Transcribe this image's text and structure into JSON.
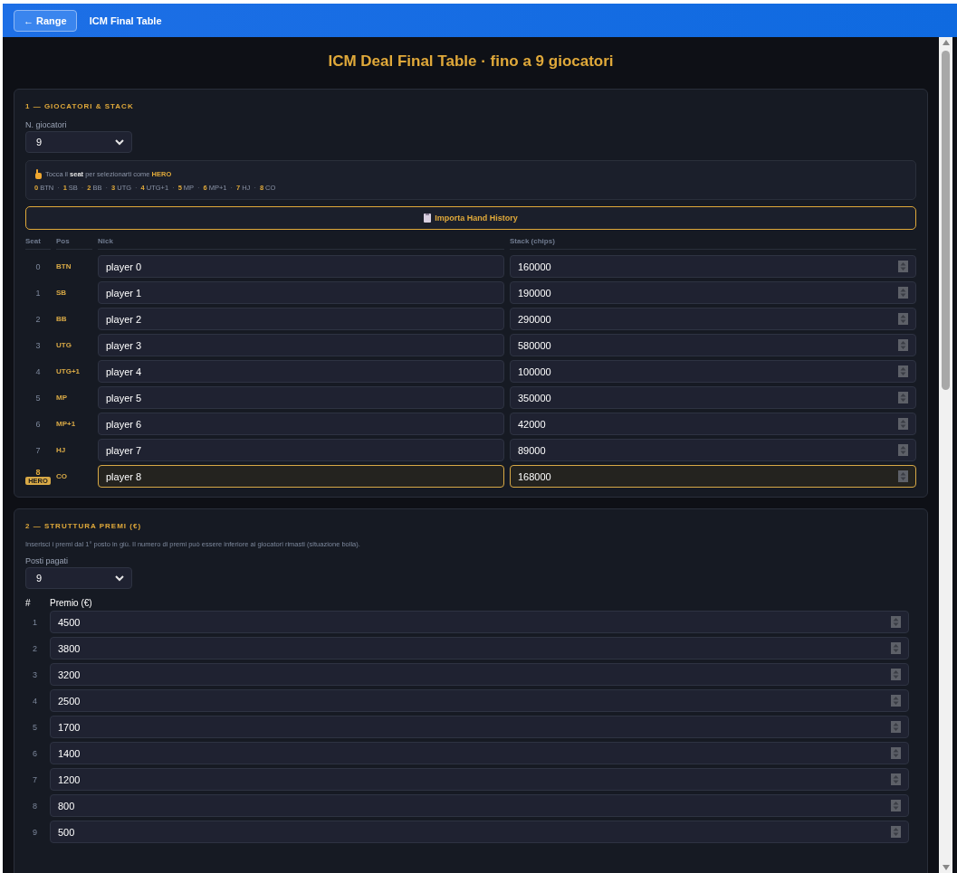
{
  "header": {
    "back_button": "← Range",
    "title": "ICM Final Table"
  },
  "page_title": "ICM Deal Final Table · fino a 9 giocatori",
  "players_section": {
    "title": "1 — GIOCATORI & STACK",
    "count_label": "N. giocatori",
    "count_value": "9",
    "hint": "Tocca il **seat** per selezionarti come **HERO**",
    "legend_separator": "·",
    "legend": [
      {
        "seat": "0",
        "pos": "BTN"
      },
      {
        "seat": "1",
        "pos": "SB"
      },
      {
        "seat": "2",
        "pos": "BB"
      },
      {
        "seat": "3",
        "pos": "UTG"
      },
      {
        "seat": "4",
        "pos": "UTG+1"
      },
      {
        "seat": "5",
        "pos": "MP"
      },
      {
        "seat": "6",
        "pos": "MP+1"
      },
      {
        "seat": "7",
        "pos": "HJ"
      },
      {
        "seat": "8",
        "pos": "CO"
      }
    ],
    "import_button": "Importa Hand History",
    "columns": [
      "Seat",
      "Pos",
      "Nick",
      "Stack (chips)"
    ],
    "hero_badge": "HERO",
    "players": [
      {
        "seat": "0",
        "pos": "BTN",
        "nick": "player 0",
        "stack": "160000",
        "hero": false
      },
      {
        "seat": "1",
        "pos": "SB",
        "nick": "player 1",
        "stack": "190000",
        "hero": false
      },
      {
        "seat": "2",
        "pos": "BB",
        "nick": "player 2",
        "stack": "290000",
        "hero": false
      },
      {
        "seat": "3",
        "pos": "UTG",
        "nick": "player 3",
        "stack": "580000",
        "hero": false
      },
      {
        "seat": "4",
        "pos": "UTG+1",
        "nick": "player 4",
        "stack": "100000",
        "hero": false
      },
      {
        "seat": "5",
        "pos": "MP",
        "nick": "player 5",
        "stack": "350000",
        "hero": false
      },
      {
        "seat": "6",
        "pos": "MP+1",
        "nick": "player 6",
        "stack": "42000",
        "hero": false
      },
      {
        "seat": "7",
        "pos": "HJ",
        "nick": "player 7",
        "stack": "89000",
        "hero": false
      },
      {
        "seat": "8",
        "pos": "CO",
        "nick": "player 8",
        "stack": "168000",
        "hero": true
      }
    ]
  },
  "prizes_section": {
    "title": "2 — STRUTTURA PREMI (€)",
    "note": "Inserisci i premi dal 1° posto in giù. Il numero di premi può essere inferiore ai giocatori rimasti (situazione bolla).",
    "paid_label": "Posti pagati",
    "paid_value": "9",
    "columns": [
      "#",
      "Premio (€)"
    ],
    "prizes": [
      {
        "place": "1",
        "amount": "4500"
      },
      {
        "place": "2",
        "amount": "3800"
      },
      {
        "place": "3",
        "amount": "3200"
      },
      {
        "place": "4",
        "amount": "2500"
      },
      {
        "place": "5",
        "amount": "1700"
      },
      {
        "place": "6",
        "amount": "1400"
      },
      {
        "place": "7",
        "amount": "1200"
      },
      {
        "place": "8",
        "amount": "800"
      },
      {
        "place": "9",
        "amount": "500"
      }
    ]
  }
}
